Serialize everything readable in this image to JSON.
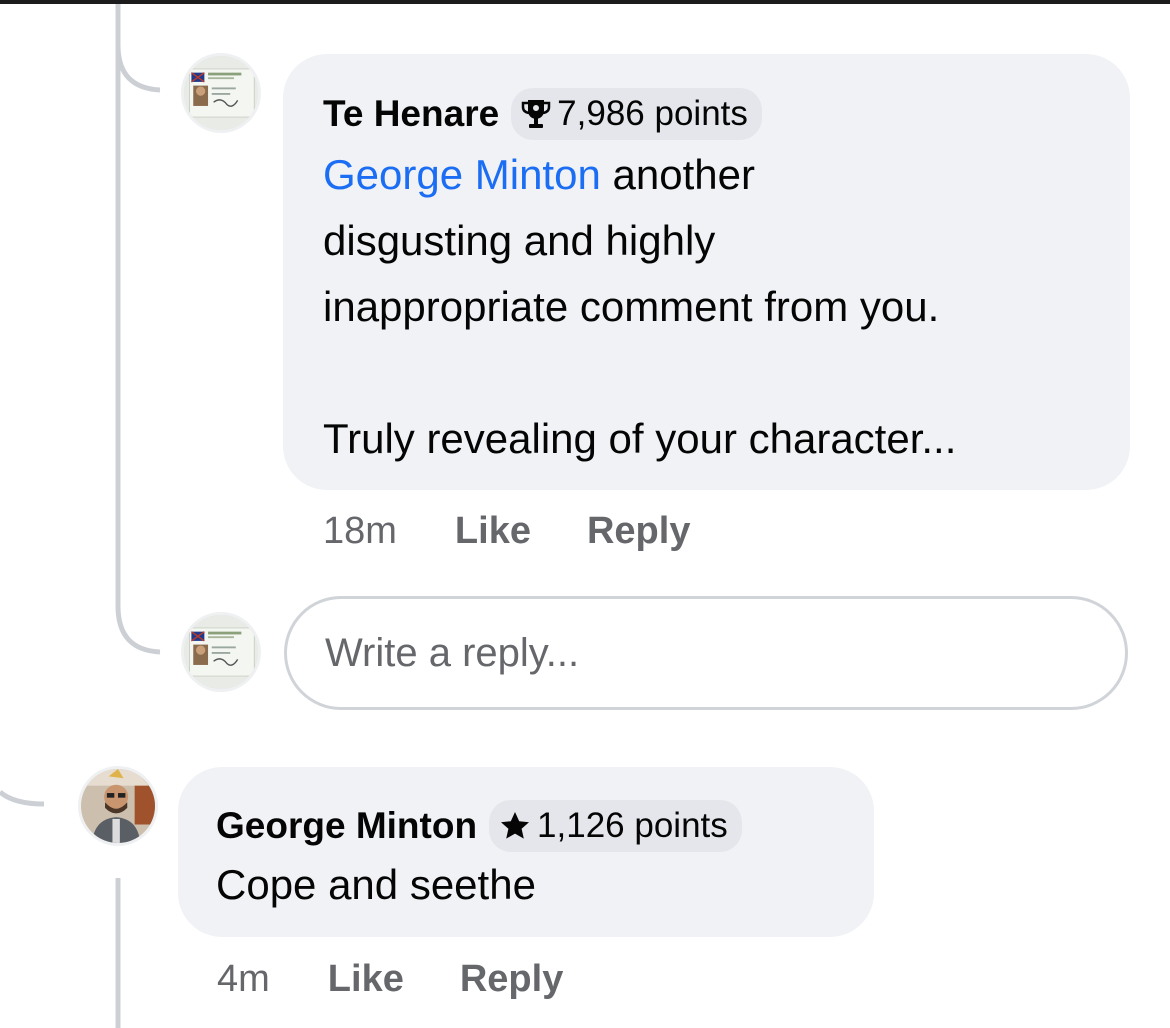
{
  "comments": [
    {
      "author": "Te Henare",
      "points": "7,986 points",
      "badge_icon": "trophy-icon",
      "mention": "George Minton",
      "text_after_mention": " another\ndisgusting and highly\ninappropriate comment from you.\n\nTruly revealing of your character...",
      "time": "18m",
      "like_label": "Like",
      "reply_label": "Reply"
    },
    {
      "author": "George Minton",
      "points": "1,126 points",
      "badge_icon": "star-icon",
      "text": "Cope and seethe",
      "time": "4m",
      "like_label": "Like",
      "reply_label": "Reply"
    }
  ],
  "reply_box": {
    "placeholder": "Write a reply..."
  },
  "colors": {
    "bubble_bg": "#f0f2f5",
    "mention": "#1b6ef3",
    "secondary_text": "#65676b",
    "thread_line": "#ccd0d5"
  }
}
